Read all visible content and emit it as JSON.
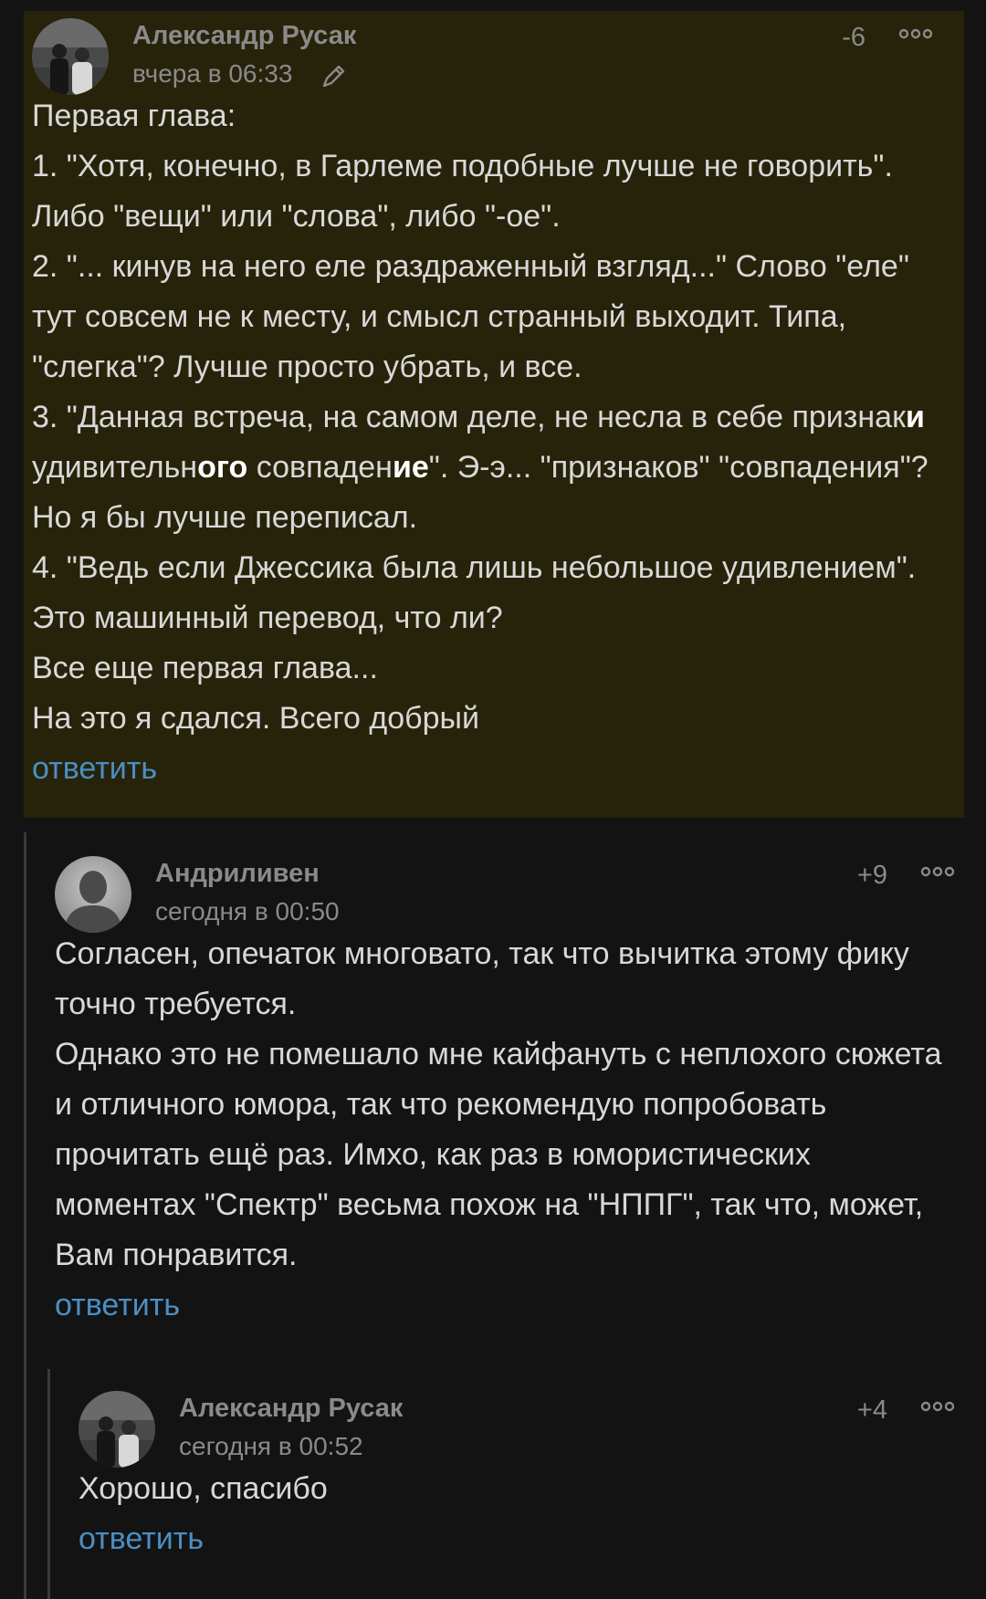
{
  "colors": {
    "background": "#131313",
    "highlight_background": "#27230a",
    "meta_text": "#8a8a8a",
    "body_text": "#d8d8d8",
    "link": "#4a8fc4",
    "thread_line": "#3a3a3a"
  },
  "comments": [
    {
      "author": "Александр Русак",
      "date": "вчера в 06:33",
      "rating": "-6",
      "edited": true,
      "icons": [
        "avatar-photo",
        "pencil-icon",
        "more-dots-icon"
      ],
      "lines": [
        "Первая глава:",
        "1. \"Хотя, конечно, в Гарлеме подобные лучше не говорить\". Либо \"вещи\" или \"слова\", либо \"-ое\".",
        "2. \"... кинув на него еле раздраженный взгляд...\" Слово \"еле\" тут совсем не к месту, и смысл странный выходит. Типа, \"слегка\"? Лучше просто убрать, и все.",
        "3. \"Данная встреча, на самом деле, не несла в себе признаки удивительного совпадение\". Э-э... \"признаков\" \"совпадения\"? Но я бы лучше переписал.",
        "4. \"Ведь если Джессика была лишь небольшое удивлением\". Это машинный перевод, что ли?",
        "Все еще первая глава...",
        "На это я сдался. Всего добрый"
      ],
      "line3_parts": {
        "a": "3. \"Данная встреча, на самом деле, не несла в себе признак",
        "b": "и",
        "c": " удивительн",
        "d": "ого",
        "e": " совпаден",
        "f": "ие",
        "g": "\". Э-э... \"признаков\" \"совпадения\"? Но я бы лучше переписал."
      },
      "reply_label": "ответить"
    },
    {
      "author": "Андриливен",
      "date": "сегодня в 00:50",
      "rating": "+9",
      "icons": [
        "default-avatar-icon",
        "more-dots-icon"
      ],
      "lines": [
        "Согласен, опечаток многовато, так что вычитка этому фику точно требуется.",
        "Однако это не помешало мне кайфануть с неплохого сюжета и отличного юмора, так что рекомендую попробовать прочитать ещё раз. Имхо, как раз в юмористических моментах \"Спектр\" весьма похож на \"НППГ\", так что, может, Вам понравится."
      ],
      "reply_label": "ответить"
    },
    {
      "author": "Александр Русак",
      "date": "сегодня в 00:52",
      "rating": "+4",
      "icons": [
        "avatar-photo",
        "more-dots-icon"
      ],
      "lines": [
        "Хорошо, спасибо"
      ],
      "reply_label": "ответить"
    }
  ]
}
